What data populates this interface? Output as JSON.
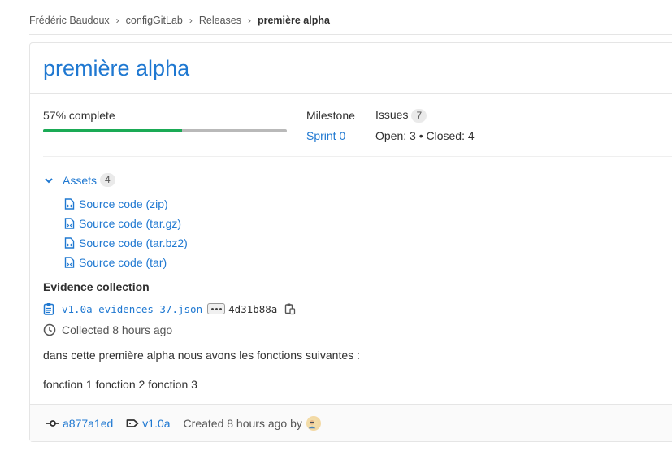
{
  "breadcrumbs": [
    "Frédéric Baudoux",
    "configGitLab",
    "Releases",
    "première alpha"
  ],
  "release": {
    "title": "première alpha"
  },
  "progress": {
    "label": "57% complete",
    "percent": 57
  },
  "milestone": {
    "label": "Milestone",
    "value": "Sprint 0"
  },
  "issues": {
    "label": "Issues",
    "count": "7",
    "summary": "Open: 3 • Closed: 4"
  },
  "assets": {
    "label": "Assets",
    "count": "4",
    "items": [
      "Source code (zip)",
      "Source code (tar.gz)",
      "Source code (tar.bz2)",
      "Source code (tar)"
    ]
  },
  "evidence": {
    "title": "Evidence collection",
    "filename": "v1.0a-evidences-37.json",
    "sha": "4d31b88a",
    "collected": "Collected 8 hours ago"
  },
  "description": [
    "dans cette première alpha nous avons les fonctions suivantes :",
    "fonction 1 fonction 2 fonction 3"
  ],
  "footer": {
    "commit": "a877a1ed",
    "tag": "v1.0a",
    "created": "Created 8 hours ago by"
  },
  "colors": {
    "link": "#1f78d1",
    "progress": "#1aaa55",
    "track": "#b9b9b9"
  }
}
